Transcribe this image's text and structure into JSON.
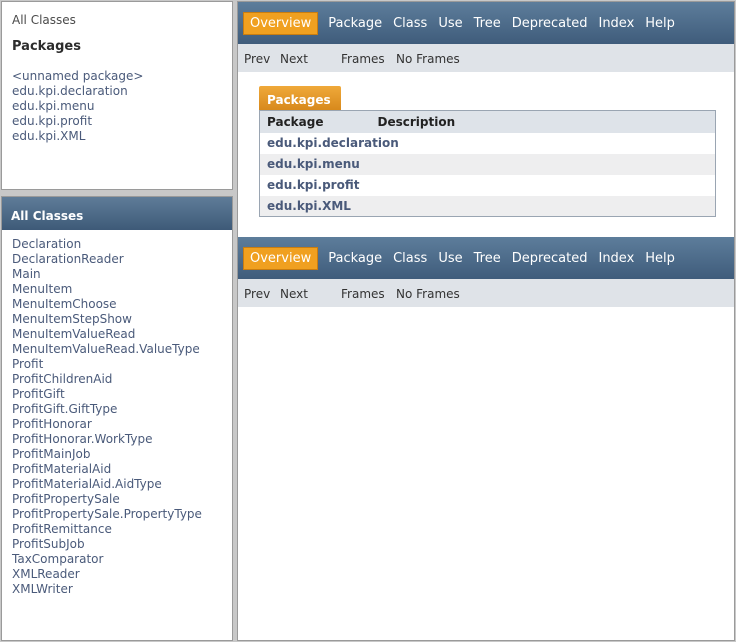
{
  "packages_frame": {
    "all_classes_link": "All Classes",
    "title": "Packages",
    "packages": [
      "<unnamed package>",
      "edu.kpi.declaration",
      "edu.kpi.menu",
      "edu.kpi.profit",
      "edu.kpi.XML"
    ]
  },
  "classes_frame": {
    "title": "All Classes",
    "classes": [
      "Declaration",
      "DeclarationReader",
      "Main",
      "MenuItem",
      "MenuItemChoose",
      "MenuItemStepShow",
      "MenuItemValueRead",
      "MenuItemValueRead.ValueType",
      "Profit",
      "ProfitChildrenAid",
      "ProfitGift",
      "ProfitGift.GiftType",
      "ProfitHonorar",
      "ProfitHonorar.WorkType",
      "ProfitMainJob",
      "ProfitMaterialAid",
      "ProfitMaterialAid.AidType",
      "ProfitPropertySale",
      "ProfitPropertySale.PropertyType",
      "ProfitRemittance",
      "ProfitSubJob",
      "TaxComparator",
      "XMLReader",
      "XMLWriter"
    ]
  },
  "navbar": {
    "items": [
      "Overview",
      "Package",
      "Class",
      "Use",
      "Tree",
      "Deprecated",
      "Index",
      "Help"
    ],
    "subnav": {
      "prev": "Prev",
      "next": "Next",
      "frames": "Frames",
      "no_frames": "No Frames"
    }
  },
  "overview": {
    "tab": "Packages",
    "columns": [
      "Package",
      "Description"
    ],
    "rows": [
      "edu.kpi.declaration",
      "edu.kpi.menu",
      "edu.kpi.profit",
      "edu.kpi.XML"
    ]
  },
  "colors": {
    "accent": "#f0a020",
    "nav_bg": "#4c6b8a",
    "link": "#4a5a7a"
  }
}
